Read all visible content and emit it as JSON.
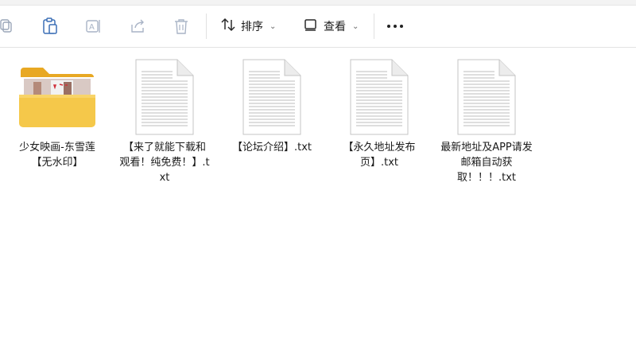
{
  "toolbar": {
    "sort_label": "排序",
    "view_label": "查看"
  },
  "files": [
    {
      "name": "少女映画-东雪莲【无水印】",
      "type": "folder"
    },
    {
      "name": "【来了就能下载和观看！纯免费！】.txt",
      "type": "txt"
    },
    {
      "name": "【论坛介绍】.txt",
      "type": "txt"
    },
    {
      "name": "【永久地址发布页】.txt",
      "type": "txt"
    },
    {
      "name": "最新地址及APP请发邮箱自动获取！！！.txt",
      "type": "txt"
    }
  ],
  "colors": {
    "folder_body": "#f5c84a",
    "folder_back": "#e8a823",
    "icon_gray": "#9a9a9a",
    "icon_blue": "#3b6fb6"
  }
}
